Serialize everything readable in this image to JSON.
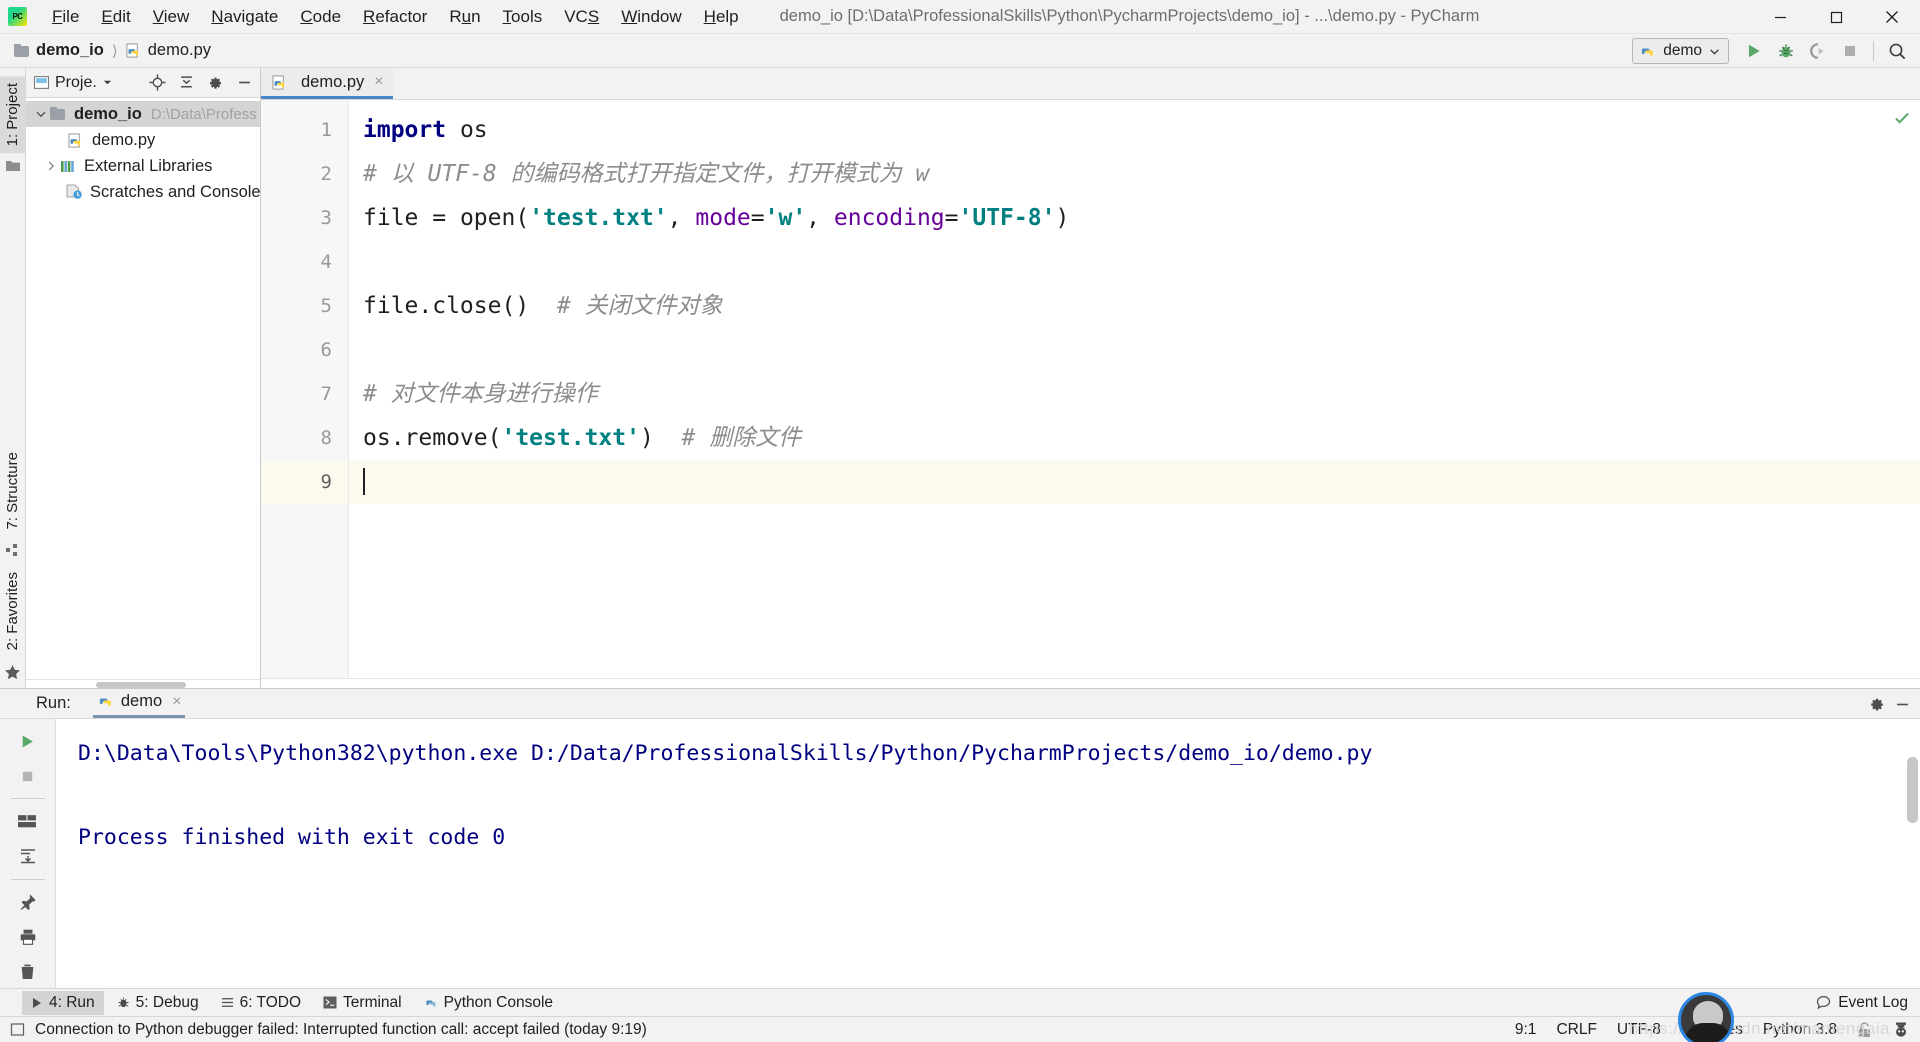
{
  "titlebar": {
    "logo": "pycharm-logo",
    "logo_text": "PC",
    "menus": [
      {
        "label": "File",
        "mn": "F"
      },
      {
        "label": "Edit",
        "mn": "E"
      },
      {
        "label": "View",
        "mn": "V"
      },
      {
        "label": "Navigate",
        "mn": "N"
      },
      {
        "label": "Code",
        "mn": "C"
      },
      {
        "label": "Refactor",
        "mn": "R"
      },
      {
        "label": "Run",
        "mn": "u"
      },
      {
        "label": "Tools",
        "mn": "T"
      },
      {
        "label": "VCS",
        "mn": "S"
      },
      {
        "label": "Window",
        "mn": "W"
      },
      {
        "label": "Help",
        "mn": "H"
      }
    ],
    "title": "demo_io [D:\\Data\\ProfessionalSkills\\Python\\PycharmProjects\\demo_io] - ...\\demo.py - PyCharm",
    "minimize": "Minimize",
    "maximize": "Restore Down",
    "close": "Close"
  },
  "navbar": {
    "breadcrumb": [
      {
        "label": "demo_io",
        "icon": "folder-icon"
      },
      {
        "label": "demo.py",
        "icon": "python-file-icon"
      }
    ],
    "run_config": "demo",
    "actions": [
      "run-button",
      "debug-button",
      "coverage-button",
      "stop-button",
      "search-everywhere-button"
    ]
  },
  "left_rail": {
    "top_tab": "1: Project",
    "bottom_tabs": [
      "7: Structure",
      "2: Favorites"
    ]
  },
  "project_panel": {
    "title": "Proje.",
    "header_actions": [
      "locate-icon",
      "collapse-all-icon",
      "settings-icon",
      "hide-icon"
    ],
    "tree": [
      {
        "label": "demo_io",
        "path": "D:\\Data\\Profess",
        "bold": true,
        "expanded": true,
        "icon": "folder-icon",
        "selected": true,
        "indent": 0
      },
      {
        "label": "demo.py",
        "path": "",
        "bold": false,
        "expanded": null,
        "icon": "python-file-icon",
        "selected": false,
        "indent": 1
      },
      {
        "label": "External Libraries",
        "path": "",
        "bold": false,
        "expanded": false,
        "icon": "library-icon",
        "selected": false,
        "indent": 0
      },
      {
        "label": "Scratches and Consoles",
        "path": "",
        "bold": false,
        "expanded": null,
        "icon": "scratches-icon",
        "selected": false,
        "indent": 0
      }
    ]
  },
  "editor": {
    "tabs": [
      {
        "label": "demo.py",
        "icon": "python-file-icon",
        "active": true,
        "close": "×"
      }
    ],
    "current_line": 9,
    "lines": [
      {
        "n": 1,
        "tokens": [
          {
            "t": "import",
            "c": "kw"
          },
          {
            "t": " os",
            "c": "plain"
          }
        ]
      },
      {
        "n": 2,
        "tokens": [
          {
            "t": "# 以 UTF-8 的编码格式打开指定文件，打开模式为 w",
            "c": "cmt"
          }
        ]
      },
      {
        "n": 3,
        "tokens": [
          {
            "t": "file = ",
            "c": "plain"
          },
          {
            "t": "open",
            "c": "fn"
          },
          {
            "t": "(",
            "c": "plain"
          },
          {
            "t": "'test.txt'",
            "c": "str"
          },
          {
            "t": ", ",
            "c": "plain"
          },
          {
            "t": "mode",
            "c": "named"
          },
          {
            "t": "=",
            "c": "plain"
          },
          {
            "t": "'w'",
            "c": "str"
          },
          {
            "t": ", ",
            "c": "plain"
          },
          {
            "t": "encoding",
            "c": "named"
          },
          {
            "t": "=",
            "c": "plain"
          },
          {
            "t": "'UTF-8'",
            "c": "str"
          },
          {
            "t": ")",
            "c": "plain"
          }
        ]
      },
      {
        "n": 4,
        "tokens": []
      },
      {
        "n": 5,
        "tokens": [
          {
            "t": "file.close()  ",
            "c": "plain"
          },
          {
            "t": "# 关闭文件对象",
            "c": "cmt"
          }
        ]
      },
      {
        "n": 6,
        "tokens": []
      },
      {
        "n": 7,
        "tokens": [
          {
            "t": "# 对文件本身进行操作",
            "c": "cmt"
          }
        ]
      },
      {
        "n": 8,
        "tokens": [
          {
            "t": "os.remove(",
            "c": "plain"
          },
          {
            "t": "'test.txt'",
            "c": "str"
          },
          {
            "t": ")  ",
            "c": "plain"
          },
          {
            "t": "# 删除文件",
            "c": "cmt"
          }
        ]
      },
      {
        "n": 9,
        "tokens": []
      }
    ]
  },
  "run_window": {
    "label": "Run:",
    "tab": "demo",
    "tab_icon": "python-icon",
    "tab_close": "×",
    "header_actions": [
      "settings-icon",
      "hide-icon"
    ],
    "rail_actions": [
      "rerun-button",
      "stop-button",
      "print-button",
      "soft-wrap-button",
      "scroll-to-end-button",
      "print-icon",
      "clear-all-button"
    ],
    "console": [
      "D:\\Data\\Tools\\Python382\\python.exe D:/Data/ProfessionalSkills/Python/PycharmProjects/demo_io/demo.py",
      "",
      "Process finished with exit code 0"
    ]
  },
  "bottom_bar": {
    "items": [
      {
        "label": "4: Run",
        "mn": "4",
        "icon": "run-icon",
        "active": true
      },
      {
        "label": "5: Debug",
        "mn": "5",
        "icon": "debug-icon",
        "active": false
      },
      {
        "label": "6: TODO",
        "mn": "6",
        "icon": "todo-icon",
        "active": false
      },
      {
        "label": "Terminal",
        "mn": "",
        "icon": "terminal-icon",
        "active": false
      },
      {
        "label": "Python Console",
        "mn": "",
        "icon": "python-icon",
        "active": false
      }
    ],
    "event_log": "Event Log",
    "event_log_icon": "balloon-icon"
  },
  "status_bar": {
    "message": "Connection to Python debugger failed: Interrupted function call: accept failed (today 9:19)",
    "message_icon": "window-icon",
    "caret_position": "9:1",
    "line_separator": "CRLF",
    "encoding": "UTF-8",
    "indent": "4 spaces",
    "interpreter": "Python 3.8",
    "lock_icon": "lock-icon",
    "avatar": "user-avatar",
    "watermark": "https://blog.csdn.net/mamengaia"
  },
  "colors": {
    "accent": "#4a86c5",
    "keyword": "#000080",
    "string": "#008080",
    "named_arg": "#660099",
    "comment": "#8c8c8c",
    "console_text": "#000080",
    "run_green": "#59a869",
    "chrome": "#f2f2f2"
  }
}
